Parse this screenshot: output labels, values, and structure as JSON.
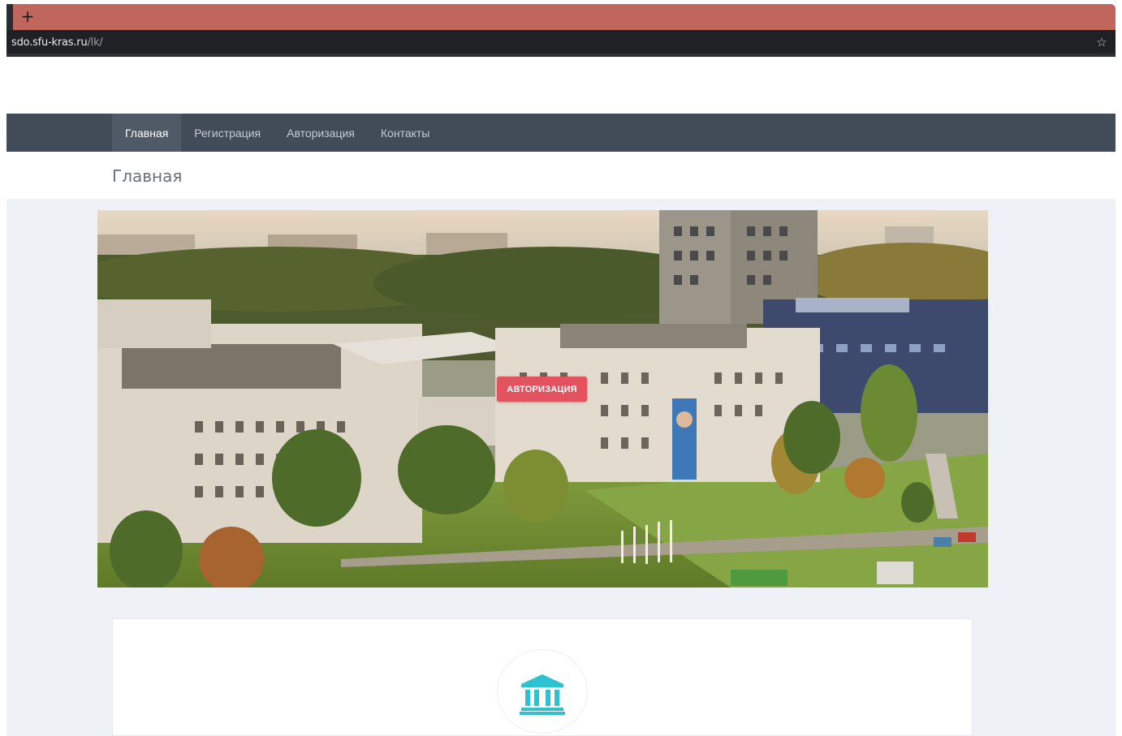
{
  "browser": {
    "new_tab_label": "+",
    "url_host": "sdo.sfu-kras.ru",
    "url_path": "/lk/",
    "bookmark_icon": "☆"
  },
  "nav": {
    "items": [
      {
        "label": "Главная",
        "active": true
      },
      {
        "label": "Регистрация",
        "active": false
      },
      {
        "label": "Авторизация",
        "active": false
      },
      {
        "label": "Контакты",
        "active": false
      }
    ]
  },
  "page": {
    "title": "Главная"
  },
  "hero": {
    "button_label": "АВТОРИЗАЦИЯ"
  },
  "card": {
    "icon": "institution-icon"
  },
  "colors": {
    "tabstrip": "#c0665c",
    "navbar": "#424c58",
    "accent_button": "#e2525f",
    "icon_teal": "#2fc1cf"
  }
}
